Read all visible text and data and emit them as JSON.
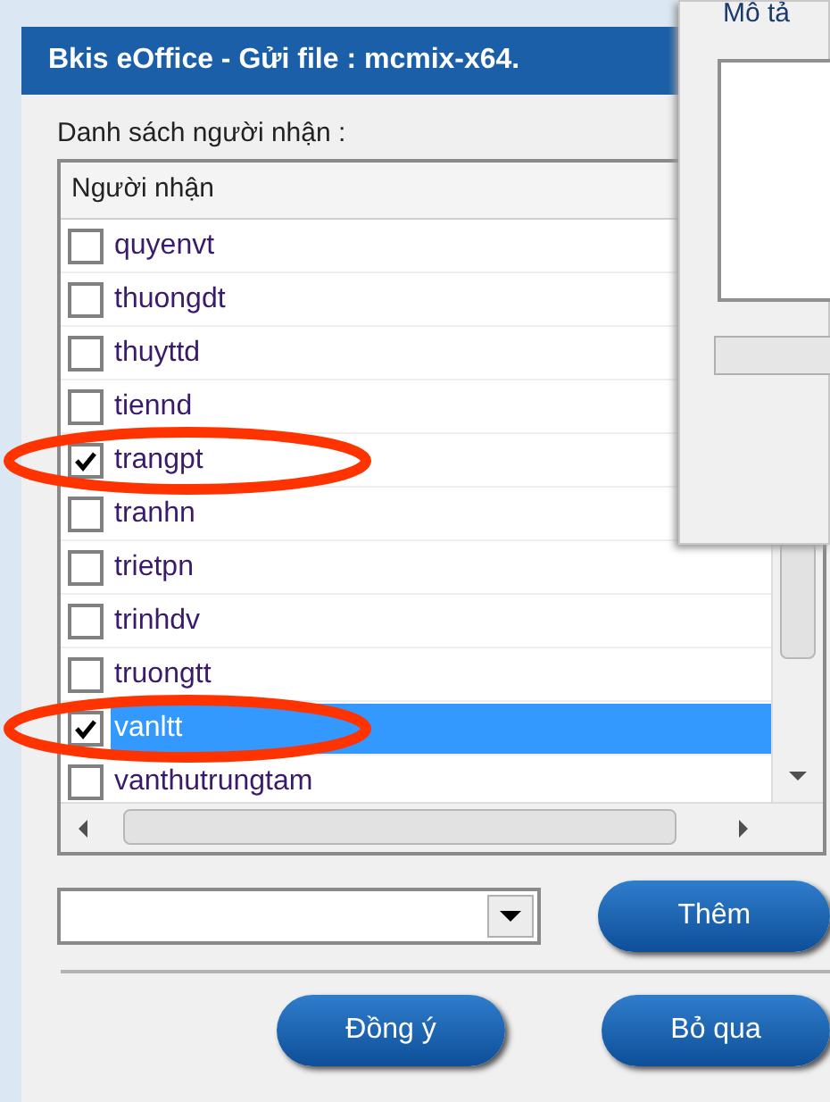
{
  "window": {
    "title": "Bkis eOffice - Gửi file : mcmix-x64."
  },
  "recipients_label": "Danh sách người nhận :",
  "list": {
    "column": "Người nhận",
    "rows": [
      {
        "name": "quyenvt",
        "checked": false,
        "selected": false
      },
      {
        "name": "thuongdt",
        "checked": false,
        "selected": false
      },
      {
        "name": "thuyttd",
        "checked": false,
        "selected": false
      },
      {
        "name": "tiennd",
        "checked": false,
        "selected": false
      },
      {
        "name": "trangpt",
        "checked": true,
        "selected": false
      },
      {
        "name": "tranhn",
        "checked": false,
        "selected": false
      },
      {
        "name": "trietpn",
        "checked": false,
        "selected": false
      },
      {
        "name": "trinhdv",
        "checked": false,
        "selected": false
      },
      {
        "name": "truongtt",
        "checked": false,
        "selected": false
      },
      {
        "name": "vanltt",
        "checked": true,
        "selected": true
      },
      {
        "name": "vanthutrungtam",
        "checked": false,
        "selected": false
      }
    ]
  },
  "add_button": "Thêm",
  "buttons": [
    "Đồng ý",
    "Bỏ qua"
  ],
  "background_window": {
    "label": "Mô tả"
  }
}
